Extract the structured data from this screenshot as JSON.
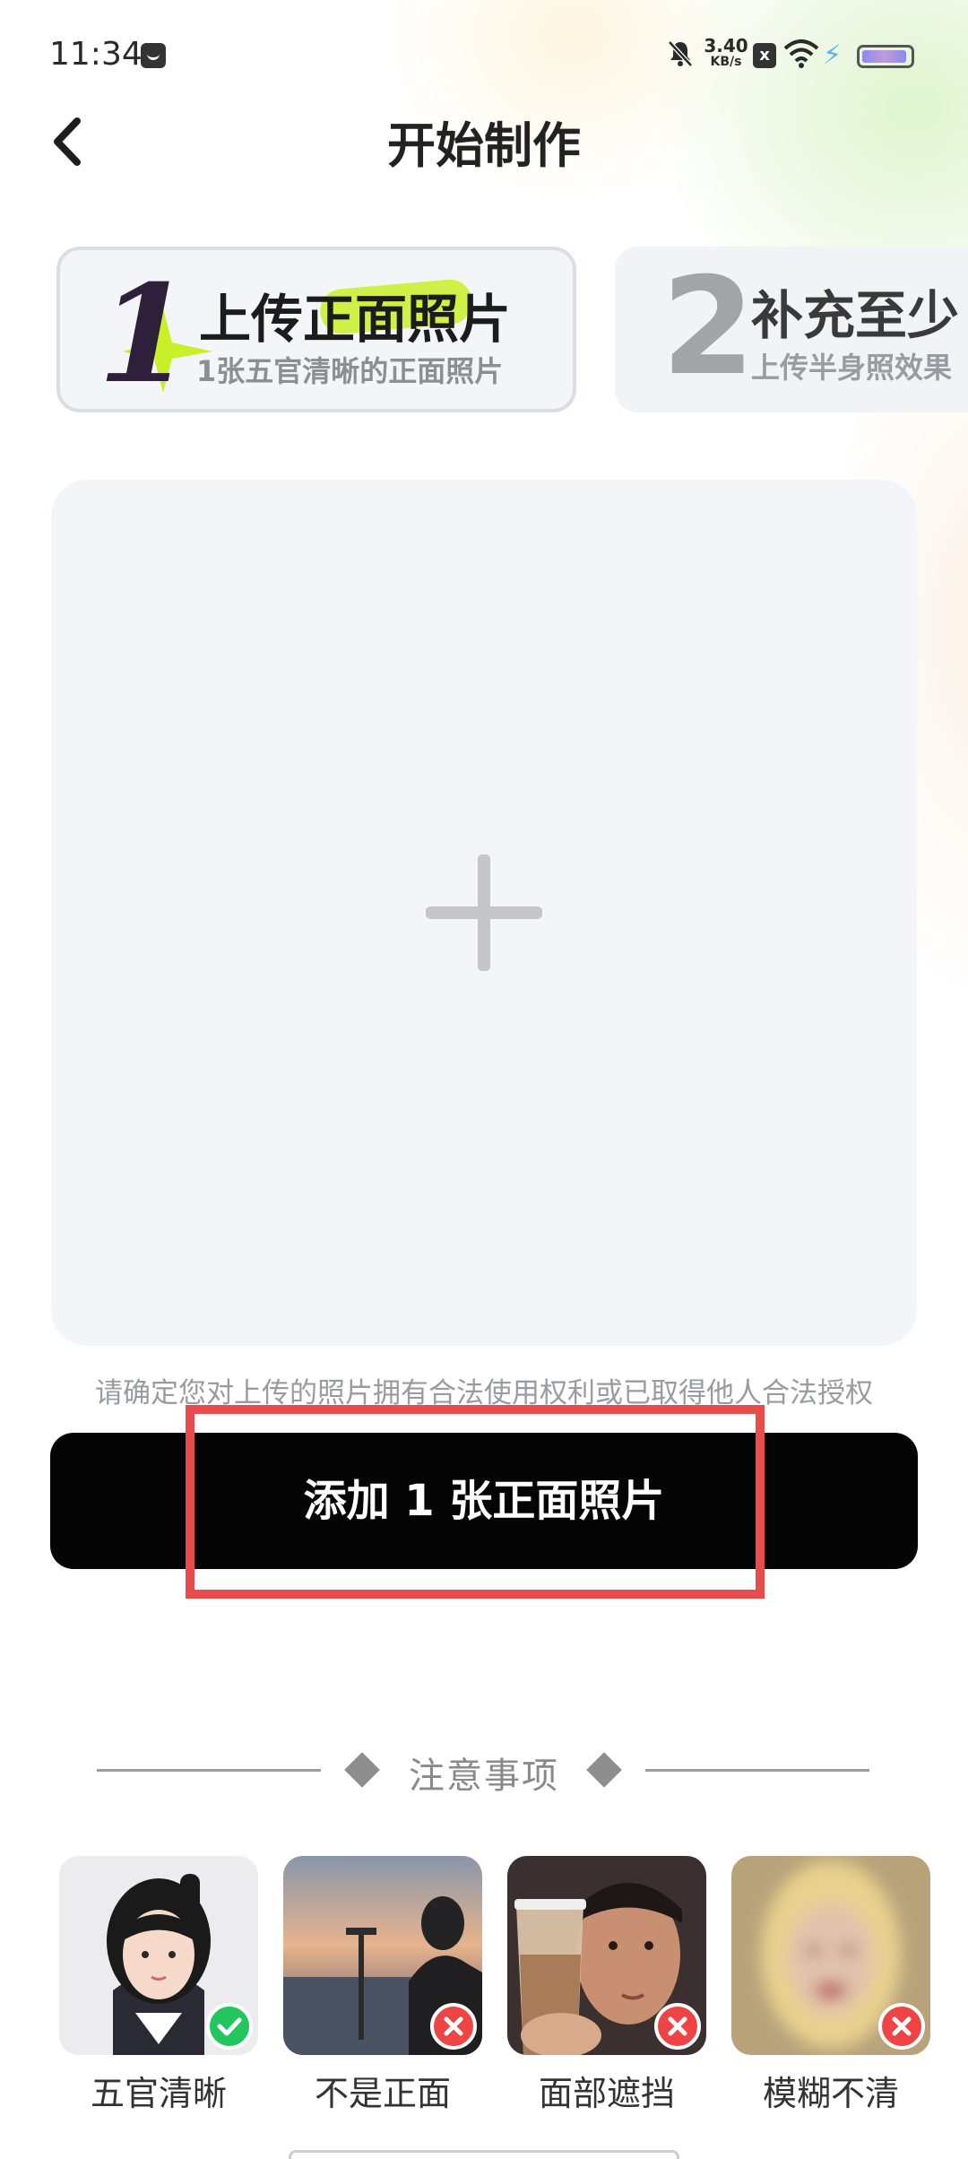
{
  "status_bar": {
    "time": "11:34",
    "net_speed_value": "3.40",
    "net_speed_unit": "KB/s",
    "sim_badge": "x",
    "charging_glyph": "⚡"
  },
  "header": {
    "title": "开始制作",
    "back_icon": "chevron-left-icon"
  },
  "steps": [
    {
      "number": "1",
      "title": "上传正面照片",
      "subtitle": "1张五官清晰的正面照片",
      "active": true
    },
    {
      "number": "2",
      "title": "补充至少",
      "subtitle": "上传半身照效果",
      "active": false
    }
  ],
  "upload": {
    "icon": "plus-icon",
    "notice": "请确定您对上传的照片拥有合法使用权利或已取得他人合法授权"
  },
  "cta": {
    "label": "添加 1 张正面照片"
  },
  "notes": {
    "title": "注意事项",
    "examples": [
      {
        "label": "五官清晰",
        "status": "ok",
        "badge_color": "#22c55e"
      },
      {
        "label": "不是正面",
        "status": "bad",
        "badge_color": "#ef4444"
      },
      {
        "label": "面部遮挡",
        "status": "bad",
        "badge_color": "#ef4444"
      },
      {
        "label": "模糊不清",
        "status": "bad",
        "badge_color": "#ef4444"
      }
    ]
  },
  "colors": {
    "accent_highlight": "#c8f028",
    "cta_background": "#050505",
    "focus_outline": "#e84c4c"
  }
}
